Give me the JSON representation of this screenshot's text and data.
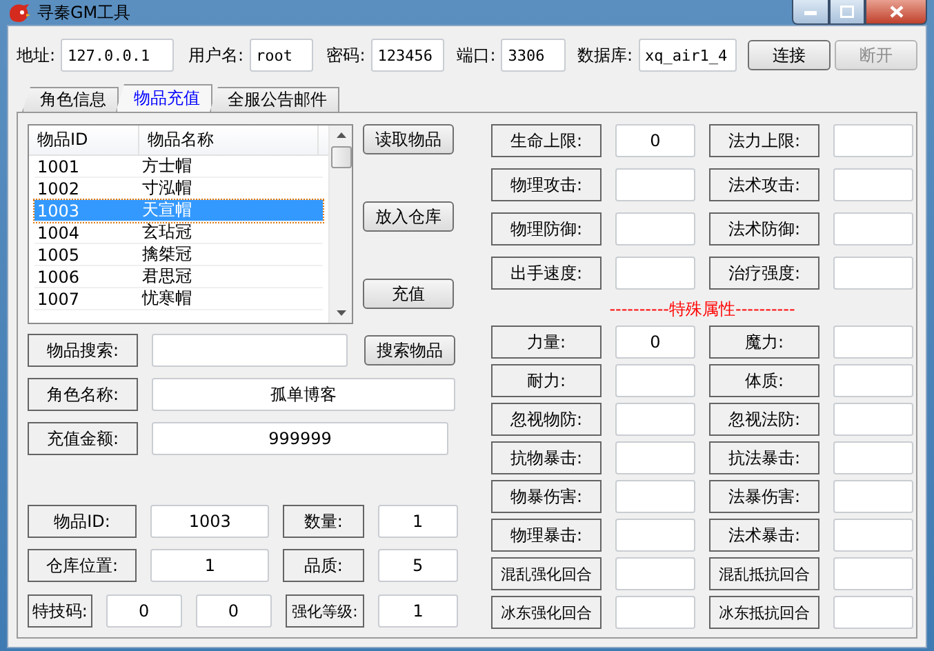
{
  "window": {
    "title": "寻秦GM工具"
  },
  "connection": {
    "fields": [
      {
        "label": "地址:",
        "value": "127.0.0.1"
      },
      {
        "label": "用户名:",
        "value": "root"
      },
      {
        "label": "密码:",
        "value": "123456"
      },
      {
        "label": "端口:",
        "value": "3306"
      },
      {
        "label": "数据库:",
        "value": "xq_air1_4"
      }
    ],
    "buttons": [
      {
        "label": "连接",
        "disabled": false
      },
      {
        "label": "断开",
        "disabled": true
      }
    ]
  },
  "tabs": [
    {
      "label": "角色信息",
      "selected": false
    },
    {
      "label": "物品充值",
      "selected": true
    },
    {
      "label": "全服公告邮件",
      "selected": false
    }
  ],
  "item_list": {
    "columns": [
      "物品ID",
      "物品名称"
    ],
    "rows": [
      {
        "id": "1001",
        "name": "方士帽",
        "selected": false
      },
      {
        "id": "1002",
        "name": "寸泓帽",
        "selected": false
      },
      {
        "id": "1003",
        "name": "天宣帽",
        "selected": true
      },
      {
        "id": "1004",
        "name": "玄玷冠",
        "selected": false
      },
      {
        "id": "1005",
        "name": "擒桀冠",
        "selected": false
      },
      {
        "id": "1006",
        "name": "君思冠",
        "selected": false
      },
      {
        "id": "1007",
        "name": "忧寒帽",
        "selected": false
      }
    ]
  },
  "list_buttons": [
    "读取物品",
    "放入仓库",
    "充值"
  ],
  "search": {
    "label": "物品搜索:",
    "button": "搜索物品"
  },
  "role_name": {
    "label": "角色名称:",
    "value": "孤单博客"
  },
  "amount": {
    "label": "充值金额:",
    "value": "999999"
  },
  "item_fields": [
    [
      {
        "label": "物品ID:",
        "value": "1003"
      },
      {
        "label": "数量:",
        "value": "1"
      }
    ],
    [
      {
        "label": "仓库位置:",
        "value": "1"
      },
      {
        "label": "品质:",
        "value": "5"
      }
    ]
  ],
  "special_code": {
    "label": "特技码:",
    "values": [
      "0",
      "0"
    ],
    "level_label": "强化等级:",
    "level_value": "1"
  },
  "base_attributes": [
    [
      {
        "label": "生命上限:",
        "value": "0"
      },
      {
        "label": "法力上限:"
      }
    ],
    [
      {
        "label": "物理攻击:"
      },
      {
        "label": "法术攻击:"
      }
    ],
    [
      {
        "label": "物理防御:"
      },
      {
        "label": "法术防御:"
      }
    ],
    [
      {
        "label": "出手速度:"
      },
      {
        "label": "治疗强度:"
      }
    ]
  ],
  "special_header": "----------特殊属性----------",
  "special_attributes": [
    [
      {
        "label": "力量:",
        "value": "0"
      },
      {
        "label": "魔力:"
      }
    ],
    [
      {
        "label": "耐力:"
      },
      {
        "label": "体质:"
      }
    ],
    [
      {
        "label": "忽视物防:"
      },
      {
        "label": "忽视法防:"
      }
    ],
    [
      {
        "label": "抗物暴击:"
      },
      {
        "label": "抗法暴击:"
      }
    ],
    [
      {
        "label": "物暴伤害:"
      },
      {
        "label": "法暴伤害:"
      }
    ],
    [
      {
        "label": "物理暴击:"
      },
      {
        "label": "法术暴击:"
      }
    ],
    [
      {
        "label": "混乱强化回合"
      },
      {
        "label": "混乱抵抗回合"
      }
    ],
    [
      {
        "label": "冰东强化回合"
      },
      {
        "label": "冰东抵抗回合"
      }
    ]
  ]
}
